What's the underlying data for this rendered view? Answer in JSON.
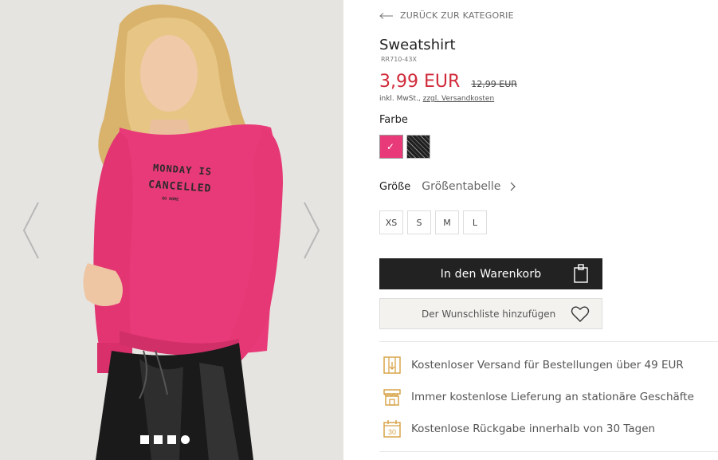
{
  "back_link": {
    "label": "ZURÜCK ZUR KATEGORIE",
    "icon": "arrow-left-icon"
  },
  "product": {
    "name": "Sweatshirt",
    "sku": "RR710-43X",
    "price": "3,99 EUR",
    "old_price": "12,99 EUR",
    "tax_prefix": "inkl. MwSt.,",
    "shipping_link": "zzgl. Versandkosten",
    "print_text": {
      "line1": "MONDAY IS",
      "line2": "CANCELLED",
      "line3": "GO HOME"
    }
  },
  "colors": {
    "label": "Farbe",
    "options": [
      {
        "name": "pink",
        "hex": "#e83a78",
        "selected": true
      },
      {
        "name": "black-melange",
        "hex": "#222222",
        "selected": false
      }
    ]
  },
  "size": {
    "label": "Größe",
    "chart_link": "Größentabelle",
    "options": [
      "XS",
      "S",
      "M",
      "L"
    ]
  },
  "actions": {
    "add_to_cart": "In den Warenkorb",
    "add_to_wishlist": "Der Wunschliste hinzufügen"
  },
  "perks": [
    {
      "icon": "delivery-box-icon",
      "text": "Kostenloser Versand für Bestellungen über 49 EUR"
    },
    {
      "icon": "store-icon",
      "text": "Immer kostenlose Lieferung an stationäre Geschäfte"
    },
    {
      "icon": "calendar-30-icon",
      "text": "Kostenlose Rückgabe innerhalb von 30 Tagen",
      "badge": "30"
    }
  ],
  "gallery": {
    "dot_count": 4,
    "active_dot": 3
  },
  "theme": {
    "accent_price": "#d12a3a",
    "icon_gold": "#d8a54a",
    "button_dark": "#222222"
  }
}
